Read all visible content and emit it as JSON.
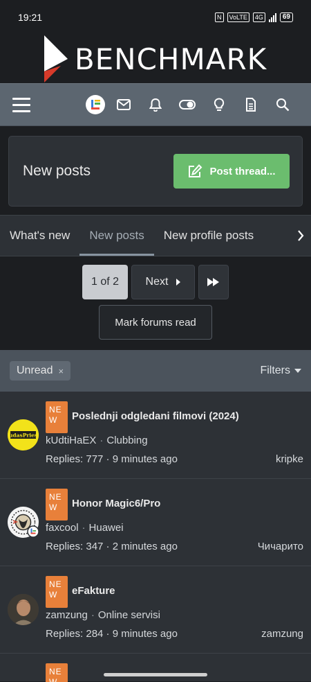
{
  "status_bar": {
    "time": "19:21",
    "volte": "VoLTE",
    "network": "4G",
    "battery": "69"
  },
  "brand": {
    "name": "BENCHMARK"
  },
  "nav": {
    "icons": [
      "menu-icon",
      "avatar",
      "mail-icon",
      "bell-icon",
      "toggle-icon",
      "lightbulb-icon",
      "document-icon",
      "search-icon"
    ]
  },
  "page": {
    "title": "New posts",
    "post_thread_label": "Post thread..."
  },
  "tabs": [
    {
      "label": "What's new"
    },
    {
      "label": "New posts"
    },
    {
      "label": "New profile posts"
    }
  ],
  "pagination": {
    "current": "1 of 2",
    "next_label": "Next"
  },
  "mark_read_label": "Mark forums read",
  "filter": {
    "chip_label": "Unread",
    "chip_close": "×",
    "filters_label": "Filters"
  },
  "badge_text": {
    "line1": "NE",
    "line2": "W"
  },
  "threads": [
    {
      "title": "Poslednji odgledani filmovi (2024)",
      "author": "kUdtiHaEX",
      "forum": "Clubbing",
      "stats": "Replies: 777 · 9 minutes ago",
      "last_poster": "kripke",
      "avatar_text": "JudasPriest"
    },
    {
      "title": "Honor Magic6/Pro",
      "author": "faxcool",
      "forum": "Huawei",
      "stats": "Replies: 347 · 2 minutes ago",
      "last_poster": "Чичарито"
    },
    {
      "title": "eFakture",
      "author": "zamzung",
      "forum": "Online servisi",
      "stats": "Replies: 284 · 9 minutes ago",
      "last_poster": "zamzung"
    }
  ],
  "colors": {
    "accent_green": "#6bbd6e",
    "new_badge": "#e8803a",
    "navbar": "#5c6670"
  }
}
